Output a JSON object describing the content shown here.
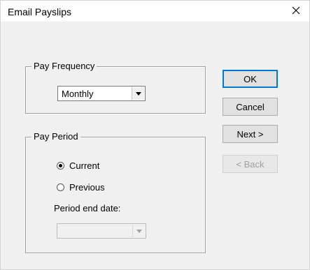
{
  "window": {
    "title": "Email Payslips",
    "close_symbol": "✕"
  },
  "pay_frequency": {
    "legend": "Pay Frequency",
    "selected": "Monthly"
  },
  "pay_period": {
    "legend": "Pay Period",
    "options": [
      {
        "label": "Current",
        "selected": true
      },
      {
        "label": "Previous",
        "selected": false
      }
    ],
    "period_end_label": "Period end date:",
    "period_end_value": ""
  },
  "buttons": {
    "ok": "OK",
    "cancel": "Cancel",
    "next": "Next >",
    "back": "< Back"
  },
  "colors": {
    "accent": "#0078d7",
    "disabled_text": "#a0a0a0"
  }
}
